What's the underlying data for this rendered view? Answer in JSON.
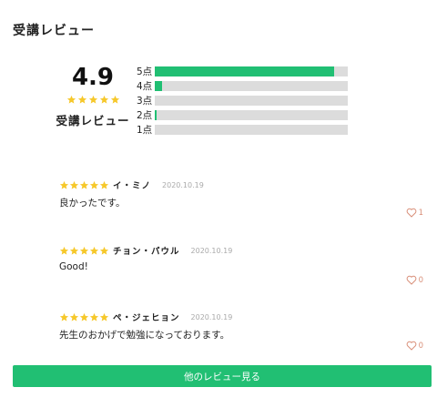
{
  "section": {
    "title": "受講レビュー"
  },
  "summary": {
    "average": "4.9",
    "label": "受講レビュー",
    "star_color": "#f6c82b"
  },
  "distribution": [
    {
      "label": "5点",
      "fraction": 0.93
    },
    {
      "label": "4点",
      "fraction": 0.04
    },
    {
      "label": "3点",
      "fraction": 0.0
    },
    {
      "label": "2点",
      "fraction": 0.01
    },
    {
      "label": "1点",
      "fraction": 0.0
    }
  ],
  "reviews": [
    {
      "stars": 5,
      "name": "イ・ミノ",
      "date": "2020.10.19",
      "text": "良かったです。",
      "likes": "1"
    },
    {
      "stars": 5,
      "name": "チョン・パウル",
      "date": "2020.10.19",
      "text": "Good!",
      "likes": "0"
    },
    {
      "stars": 5,
      "name": "ペ・ジェヒョン",
      "date": "2020.10.19",
      "text": "先生のおかげで勉強になっております。",
      "likes": "0"
    }
  ],
  "more_button": {
    "label": "他のレビュー見る"
  },
  "colors": {
    "accent": "#21bf73",
    "track": "#dcdcdc",
    "heart": "#d9907a"
  }
}
